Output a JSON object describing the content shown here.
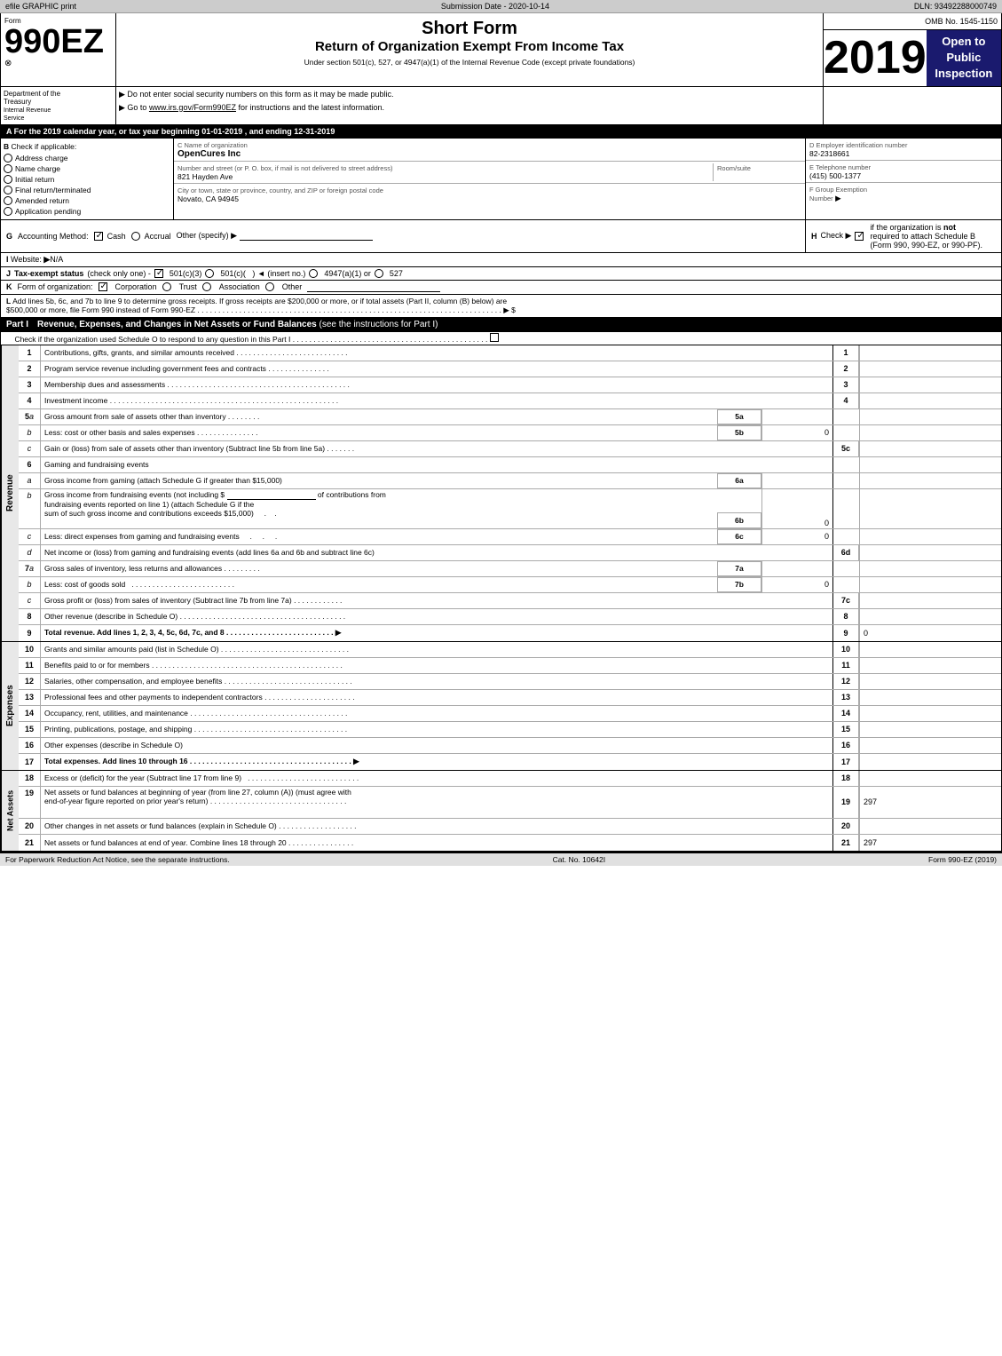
{
  "efile_bar": {
    "left": "efile GRAPHIC print",
    "middle": "Submission Date - 2020-10-14",
    "right": "DLN: 93492288000749"
  },
  "form": {
    "number": "990EZ",
    "sub": "⊗",
    "omb": "OMB No. 1545-1150",
    "year": "2019",
    "open_public": "Open to\nPublic\nInspection",
    "short_form": "Short Form",
    "return_title": "Return of Organization Exempt From Income Tax",
    "subtitle": "Under section 501(c), 527, or 4947(a)(1) of the Internal Revenue Code (except private foundations)",
    "dept_label": "Department of the\nTreasury",
    "dept_sub": "Internal Revenue\nService",
    "inst1": "▶ Do not enter social security numbers on this form as it may be made public.",
    "inst2": "▶ Go to www.irs.gov/Form990EZ for instructions and the latest information.",
    "inst2_link": "www.irs.gov/Form990EZ"
  },
  "year_row": {
    "text": "A For the 2019 calendar year, or tax year beginning 01-01-2019 , and ending 12-31-2019"
  },
  "check_section": {
    "b_label": "B Check if applicable:",
    "checks": [
      {
        "id": "address_change",
        "label": "Address charge",
        "checked": false
      },
      {
        "id": "name_change",
        "label": "Name charge",
        "checked": false
      },
      {
        "id": "initial_return",
        "label": "Initial return",
        "checked": false
      },
      {
        "id": "final_return",
        "label": "Final return/terminated",
        "checked": false
      },
      {
        "id": "amended_return",
        "label": "Amended return",
        "checked": false
      },
      {
        "id": "application_pending",
        "label": "Application pending",
        "checked": false
      }
    ],
    "c_label": "C Name of organization",
    "org_name": "OpenCures Inc",
    "address_label": "Number and street (or P. O. box, if mail is not delivered to street address)",
    "address_value": "821 Hayden Ave",
    "room_label": "Room/suite",
    "room_value": "",
    "city_label": "City or town, state or province, country, and ZIP or foreign postal code",
    "city_value": "Novato, CA  94945",
    "d_label": "D Employer identification number",
    "ein": "82-2318661",
    "e_label": "E Telephone number",
    "phone": "(415) 500-1377",
    "f_label": "F Group Exemption\nNumber",
    "f_arrow": "▶"
  },
  "section_g": {
    "label": "G",
    "text": "Accounting Method:",
    "cash_checked": true,
    "accrual_checked": false,
    "cash_label": "Cash",
    "accrual_label": "Accrual",
    "other_label": "Other (specify) ▶",
    "other_line": "____________________________"
  },
  "section_h": {
    "label": "H",
    "text": "Check ▶",
    "checkbox_checked": true,
    "if_text": "if the organization is not\nrequired to attach Schedule B\n(Form 990, 990-EZ, or 990-PF)."
  },
  "section_i": {
    "label": "I",
    "text": "Website: ▶N/A"
  },
  "section_j": {
    "label": "J",
    "text": "Tax-exempt status",
    "options": "501(c)(3) ☐ 501(c)( ) ◄ (insert no.) ☐ 4947(a)(1) or ☐ 527",
    "checked": "501(c)(3)"
  },
  "section_k": {
    "label": "K",
    "text": "Form of organization:",
    "corporation_checked": true,
    "options": [
      "Corporation",
      "Trust",
      "Association",
      "Other"
    ]
  },
  "section_l": {
    "label": "L",
    "text": "Add lines 5b, 6c, and 7b to line 9 to determine gross receipts. If gross receipts are $200,000 or more, or if total assets (Part II, column (B) below) are $500,000 or more, file Form 990 instead of Form 990-EZ",
    "dots": ". . . . . . . . . . . . . . . . . . . . . . . . . . . . . . . . . . . . . . . . . . . . . . ▶ $"
  },
  "part1": {
    "label": "Part I",
    "title": "Revenue, Expenses, and Changes in Net Assets or Fund Balances",
    "subtitle": "(see the instructions for Part I)",
    "check_text": "Check if the organization used Schedule O to respond to any question in this Part I",
    "check_dots": ". . . . . . . . . . . . . . . . . . . . . . . . . ☐"
  },
  "revenue_rows": [
    {
      "num": "1",
      "desc": "Contributions, gifts, grants, and similar amounts received . . . . . . . . . . . . . . . . . . . . . . . . . . .",
      "line": "1",
      "value": ""
    },
    {
      "num": "2",
      "desc": "Program service revenue including government fees and contracts . . . . . . . . . . . . . . .",
      "line": "2",
      "value": ""
    },
    {
      "num": "3",
      "desc": "Membership dues and assessments . . . . . . . . . . . . . . . . . . . . . . . . . . . . . . . . . . . . . . . . . . . .",
      "line": "3",
      "value": ""
    },
    {
      "num": "4",
      "desc": "Investment income . . . . . . . . . . . . . . . . . . . . . . . . . . . . . . . . . . . . . . . . . . . . . . . . . . . . . . .",
      "line": "4",
      "value": ""
    }
  ],
  "revenue_5": {
    "a_desc": "Gross amount from sale of assets other than inventory . . . . . . . .",
    "a_ref": "5a",
    "a_value": "",
    "b_desc": "Less: cost or other basis and sales expenses . . . . . . . . . . . . . . .",
    "b_ref": "5b",
    "b_value": "0",
    "c_desc": "Gain or (loss) from sale of assets other than inventory (Subtract line 5b from line 5a) . . . . . . .",
    "c_line": "5c",
    "c_value": ""
  },
  "revenue_6": {
    "header": "Gaming and fundraising events",
    "a_desc": "Gross income from gaming (attach Schedule G if greater than $15,000)",
    "a_ref": "6a",
    "a_value": "",
    "b_desc": "Gross income from fundraising events (not including $",
    "b_desc2": "of contributions from\nfundraising events reported on line 1) (attach Schedule G if the\nsum of such gross income and contributions exceeds $15,000)",
    "b_ref": "6b",
    "b_value": "0",
    "c_desc": "Less: direct expenses from gaming and fundraising events",
    "c_ref_label": ". . .",
    "c_ref": "6c",
    "c_value": "0",
    "d_desc": "Net income or (loss) from gaming and fundraising events (add lines 6a and 6b and subtract line 6c)",
    "d_line": "6d",
    "d_value": ""
  },
  "revenue_7": {
    "a_desc": "Gross sales of inventory, less returns and allowances . . . . . . . . .",
    "a_ref": "7a",
    "a_value": "",
    "b_desc": "Less: cost of goods sold",
    "b_dots": ". . . . . . . . . . . . . . . . . . . . . . . . .",
    "b_ref": "7b",
    "b_value": "0",
    "c_desc": "Gross profit or (loss) from sales of inventory (Subtract line 7b from line 7a) . . . . . . . . . . . .",
    "c_line": "7c",
    "c_value": ""
  },
  "revenue_8": {
    "num": "8",
    "desc": "Other revenue (describe in Schedule O) . . . . . . . . . . . . . . . . . . . . . . . . . . . . . . . . . . . . . . . .",
    "line": "8",
    "value": ""
  },
  "revenue_9": {
    "num": "9",
    "desc": "Total revenue. Add lines 1, 2, 3, 4, 5c, 6d, 7c, and 8 . . . . . . . . . . . . . . . . . . . . . . . . . . ▶",
    "line": "9",
    "value": "0"
  },
  "expenses_rows": [
    {
      "num": "10",
      "desc": "Grants and similar amounts paid (list in Schedule O) . . . . . . . . . . . . . . . . . . . . . . . . . . . . . . .",
      "line": "10",
      "value": ""
    },
    {
      "num": "11",
      "desc": "Benefits paid to or for members . . . . . . . . . . . . . . . . . . . . . . . . . . . . . . . . . . . . . . . . . . . . . .",
      "line": "11",
      "value": ""
    },
    {
      "num": "12",
      "desc": "Salaries, other compensation, and employee benefits . . . . . . . . . . . . . . . . . . . . . . . . . . . . . . .",
      "line": "12",
      "value": ""
    },
    {
      "num": "13",
      "desc": "Professional fees and other payments to independent contractors . . . . . . . . . . . . . . . . . . . . . .",
      "line": "13",
      "value": ""
    },
    {
      "num": "14",
      "desc": "Occupancy, rent, utilities, and maintenance . . . . . . . . . . . . . . . . . . . . . . . . . . . . . . . . . . . . . .",
      "line": "14",
      "value": ""
    },
    {
      "num": "15",
      "desc": "Printing, publications, postage, and shipping . . . . . . . . . . . . . . . . . . . . . . . . . . . . . . . . . . . . .",
      "line": "15",
      "value": ""
    },
    {
      "num": "16",
      "desc": "Other expenses (describe in Schedule O)",
      "line": "16",
      "value": ""
    },
    {
      "num": "17",
      "desc": "Total expenses. Add lines 10 through 16 . . . . . . . . . . . . . . . . . . . . . . . . . . . . . . . . . . . . . . . ▶",
      "line": "17",
      "value": "",
      "bold": true
    }
  ],
  "netassets_rows": [
    {
      "num": "18",
      "desc": "Excess or (deficit) for the year (Subtract line 17 from line 9)",
      "dots": ". . . . . . . . . . . . . . . . . . . . . . . . . . .",
      "line": "18",
      "value": ""
    },
    {
      "num": "19",
      "desc": "Net assets or fund balances at beginning of year (from line 27, column (A)) (must agree with\nend-of-year figure reported on prior year's return) . . . . . . . . . . . . . . . . . . . . . . . . . . . . . . . . .",
      "line": "19",
      "value": "297"
    },
    {
      "num": "20",
      "desc": "Other changes in net assets or fund balances (explain in Schedule O) . . . . . . . . . . . . . . . . . . .",
      "line": "20",
      "value": ""
    },
    {
      "num": "21",
      "desc": "Net assets or fund balances at end of year. Combine lines 18 through 20 . . . . . . . . . . . . . . . .",
      "line": "21",
      "value": "297"
    }
  ],
  "footer": {
    "left": "For Paperwork Reduction Act Notice, see the separate instructions.",
    "middle": "Cat. No. 10642I",
    "right": "Form 990-EZ (2019)"
  }
}
